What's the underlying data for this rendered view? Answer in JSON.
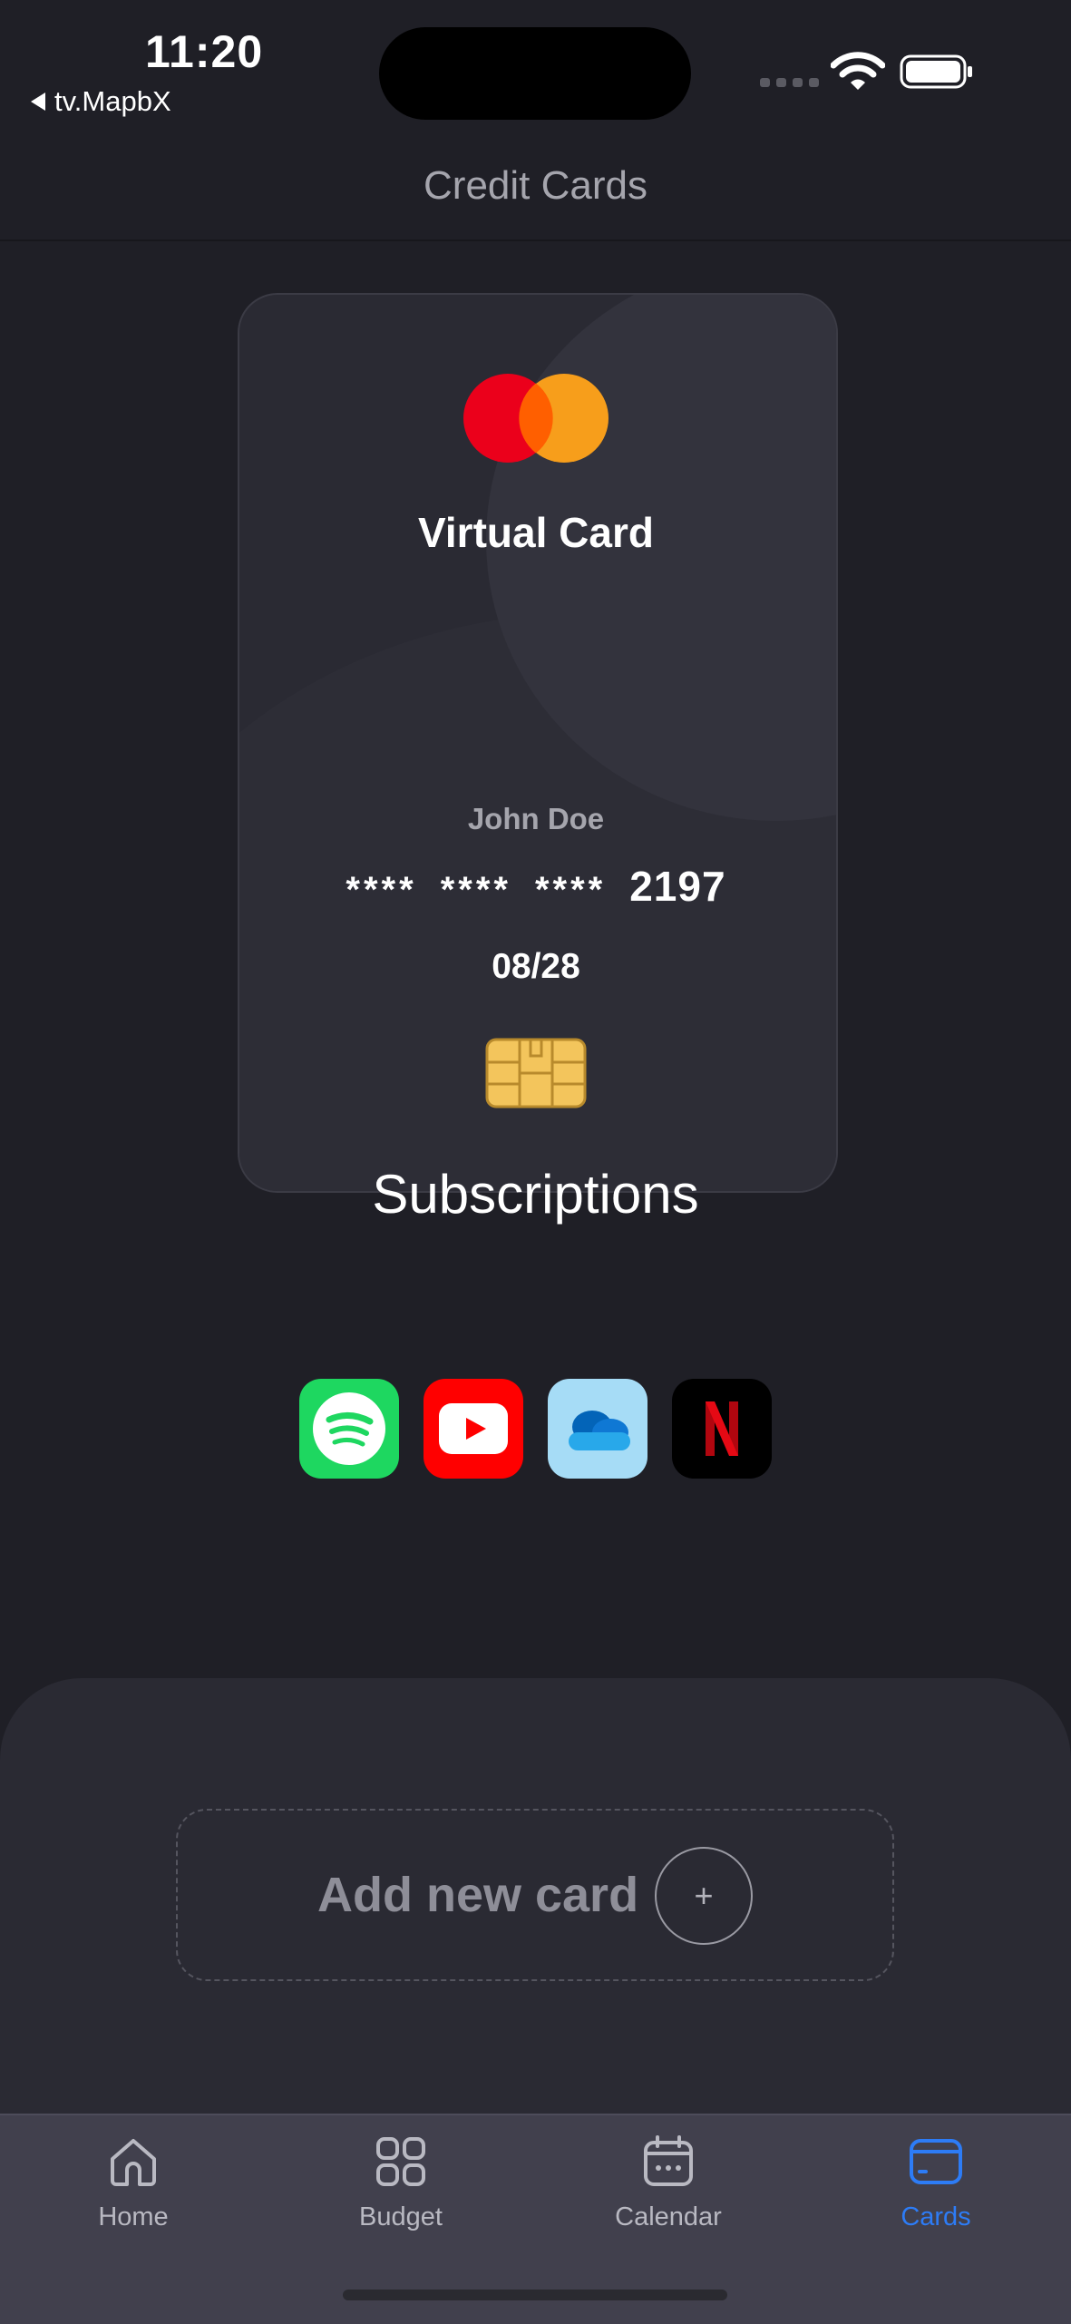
{
  "status_bar": {
    "time": "11:20",
    "back_app": "tv.MapbX"
  },
  "nav": {
    "title": "Credit Cards"
  },
  "card": {
    "brand_icon": "mastercard-logo",
    "title": "Virtual Card",
    "holder": "John Doe",
    "number_masked": [
      "****",
      "****",
      "****"
    ],
    "number_last4": "2197",
    "expiry": "08/28",
    "chip_icon": "sim-chip-icon"
  },
  "subscriptions": {
    "title": "Subscriptions",
    "apps": [
      {
        "name": "Spotify",
        "icon": "spotify-icon",
        "color": "#1ed760"
      },
      {
        "name": "YouTube",
        "icon": "youtube-icon",
        "color": "#ff0000"
      },
      {
        "name": "OneDrive",
        "icon": "onedrive-icon",
        "color": "#a6dcf6"
      },
      {
        "name": "Netflix",
        "icon": "netflix-icon",
        "color": "#000000"
      }
    ]
  },
  "add_card": {
    "label": "Add new card",
    "plus": "+"
  },
  "tabs": [
    {
      "label": "Home",
      "icon": "home-icon",
      "active": false
    },
    {
      "label": "Budget",
      "icon": "grid-icon",
      "active": false
    },
    {
      "label": "Calendar",
      "icon": "calendar-icon",
      "active": false
    },
    {
      "label": "Cards",
      "icon": "credit-card-icon",
      "active": true
    }
  ],
  "colors": {
    "background": "#1f1f26",
    "accent": "#2d7cf6",
    "card": "#2a2a33",
    "tabbar": "#41404d"
  }
}
